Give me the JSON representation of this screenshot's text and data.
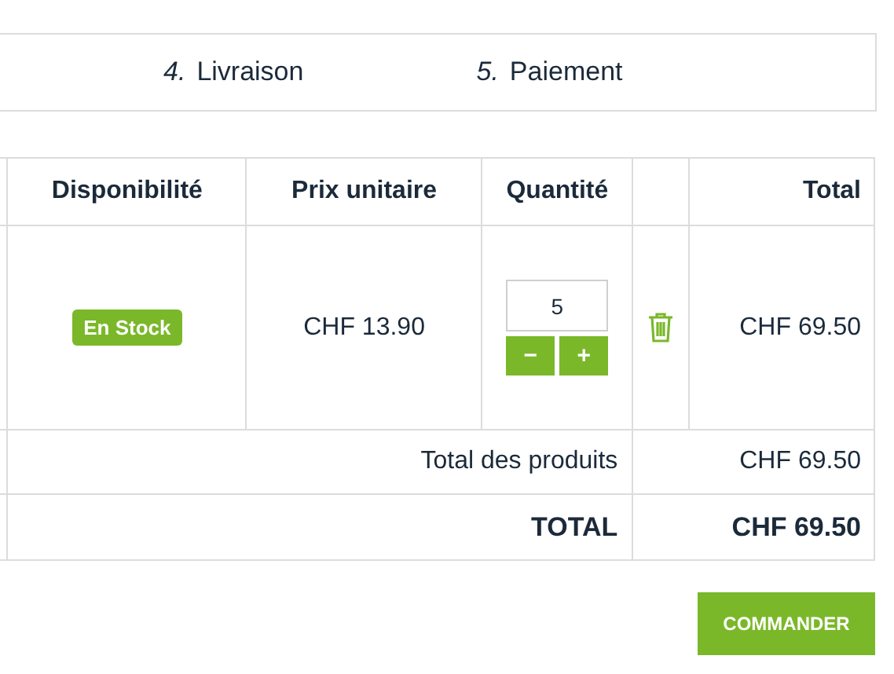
{
  "steps": [
    {
      "number": "4.",
      "label": "Livraison"
    },
    {
      "number": "5.",
      "label": "Paiement"
    }
  ],
  "table": {
    "columns": [
      "Disponibilité",
      "Prix unitaire",
      "Quantité",
      "Total"
    ],
    "rows": [
      {
        "availability": "En Stock",
        "unit_price": "CHF 13.90",
        "quantity": "5",
        "decrease": "−",
        "increase": "+",
        "total": "CHF 69.50"
      }
    ],
    "subtotal": {
      "label": "Total des produits",
      "value": "CHF 69.50"
    },
    "grand_total": {
      "label": "TOTAL",
      "value": "CHF 69.50"
    }
  },
  "order_button": "COMMANDER"
}
